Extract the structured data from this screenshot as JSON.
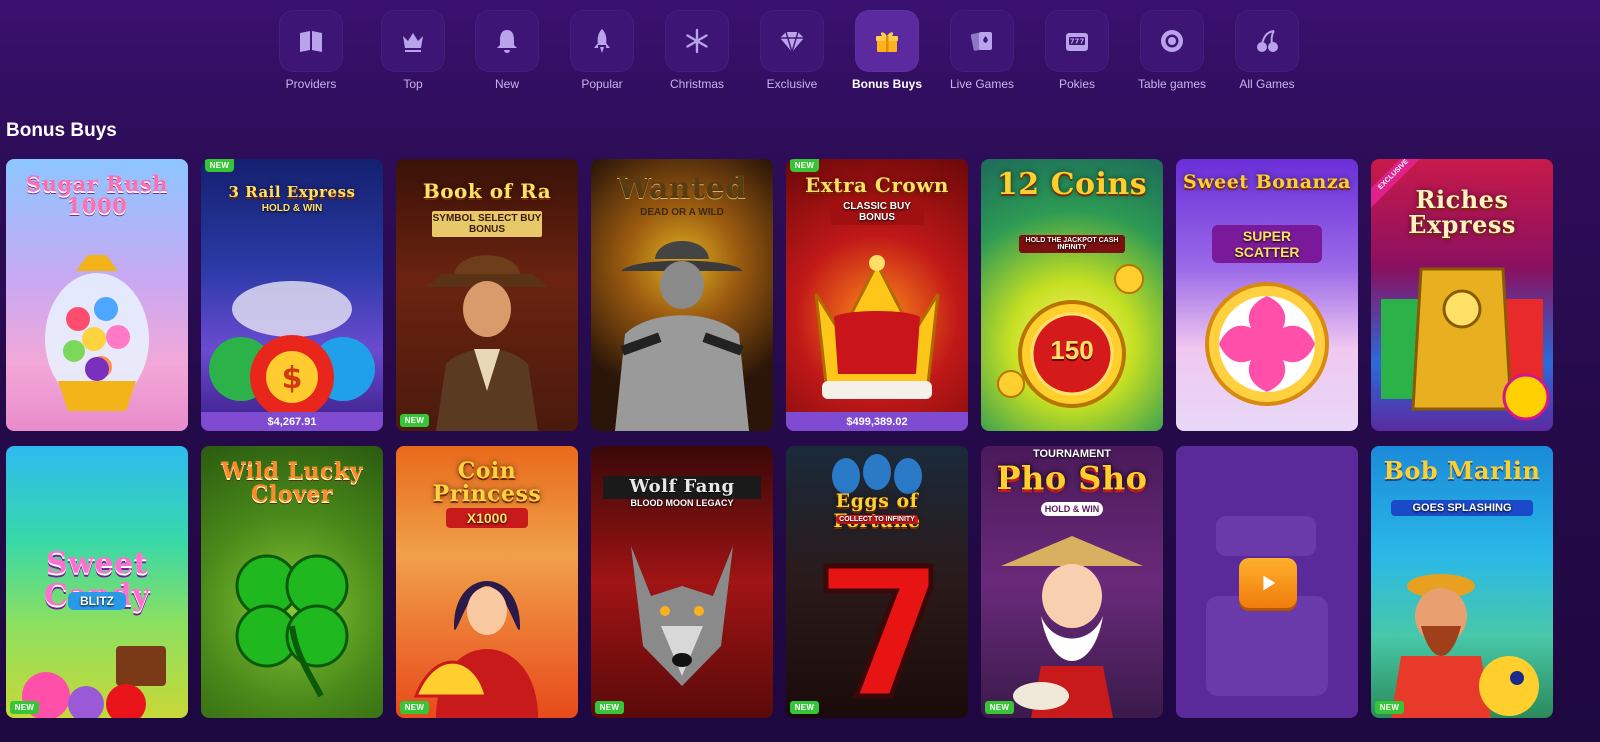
{
  "categories": [
    {
      "label": "Providers",
      "icon": "book-icon",
      "active": false
    },
    {
      "label": "Top",
      "icon": "crown-icon",
      "active": false
    },
    {
      "label": "New",
      "icon": "bell-icon",
      "active": false
    },
    {
      "label": "Popular",
      "icon": "rocket-icon",
      "active": false
    },
    {
      "label": "Christmas",
      "icon": "snowflake-icon",
      "active": false
    },
    {
      "label": "Exclusive",
      "icon": "diamond-icon",
      "active": false
    },
    {
      "label": "Bonus Buys",
      "icon": "gift-icon",
      "active": true
    },
    {
      "label": "Live Games",
      "icon": "cards-icon",
      "active": false
    },
    {
      "label": "Pokies",
      "icon": "slot-machine-icon",
      "active": false
    },
    {
      "label": "Table games",
      "icon": "chip-icon",
      "active": false
    },
    {
      "label": "All Games",
      "icon": "cherries-icon",
      "active": false
    }
  ],
  "section": {
    "title": "Bonus Buys"
  },
  "games": [
    {
      "title": "Sugar Rush 1000",
      "subtitle": "",
      "badge": "",
      "jackpot": ""
    },
    {
      "title": "3 Rail Express",
      "subtitle": "HOLD & WIN",
      "badge": "NEW",
      "jackpot": "$4,267.91"
    },
    {
      "title": "Book of Ra",
      "subtitle": "SYMBOL SELECT BUY BONUS",
      "badge": "NEW",
      "jackpot": ""
    },
    {
      "title": "Wanted",
      "subtitle": "DEAD OR A WILD",
      "badge": "",
      "jackpot": ""
    },
    {
      "title": "Extra Crown",
      "subtitle": "CLASSIC BUY BONUS",
      "badge": "NEW",
      "jackpot": "$499,389.02"
    },
    {
      "title": "12 Coins",
      "subtitle": "HOLD THE JACKPOT CASH INFINITY",
      "badge": "",
      "jackpot": "",
      "value": "150"
    },
    {
      "title": "Sweet Bonanza",
      "subtitle": "SUPER SCATTER",
      "badge": "",
      "jackpot": ""
    },
    {
      "title": "Riches Express",
      "subtitle": "",
      "badge": "EXCLUSIVE",
      "jackpot": ""
    },
    {
      "title": "Sweet Candy",
      "subtitle": "BLITZ",
      "badge": "NEW",
      "jackpot": ""
    },
    {
      "title": "Wild Lucky Clover",
      "subtitle": "",
      "badge": "",
      "jackpot": ""
    },
    {
      "title": "Coin Princess",
      "subtitle": "X1000",
      "badge": "NEW",
      "jackpot": ""
    },
    {
      "title": "Wolf Fang",
      "subtitle": "BLOOD MOON LEGACY",
      "badge": "NEW",
      "jackpot": ""
    },
    {
      "title": "Eggs of Fortune",
      "subtitle": "COLLECT TO INFINITY",
      "badge": "NEW",
      "jackpot": ""
    },
    {
      "title": "Pho Sho",
      "subtitle": "HOLD & WIN",
      "badge": "NEW",
      "jackpot": "",
      "tag": "TOURNAMENT"
    },
    {
      "title": "",
      "subtitle": "",
      "badge": "",
      "jackpot": "",
      "placeholder": true
    },
    {
      "title": "Bob Marlin",
      "subtitle": "GOES SPLASHING",
      "badge": "NEW",
      "jackpot": ""
    }
  ]
}
